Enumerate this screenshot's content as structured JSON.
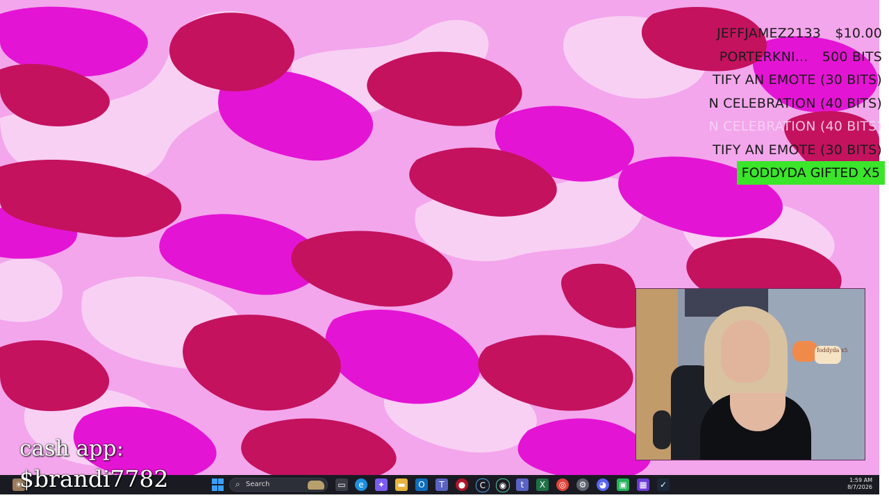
{
  "colors": {
    "camo_light": "#f6c6f2",
    "camo_mid": "#ee82e4",
    "camo_magenta": "#e414d4",
    "camo_dark": "#c4125e",
    "gift_badge_bg": "#3ae52a",
    "taskbar_bg": "#1a1b22"
  },
  "alerts": {
    "rows": [
      {
        "text": "JEFFJAMEZ2133",
        "amount": "$10.00"
      },
      {
        "text": "PORTERKNI...",
        "amount": "500 BITS"
      },
      {
        "text": "TIFY AN EMOTE (30 BITS)",
        "amount": ""
      },
      {
        "text": "N CELEBRATION (40 BITS)",
        "amount": ""
      },
      {
        "text": "N CELEBRATION (40 BITS)",
        "amount": ""
      },
      {
        "text": "TIFY AN EMOTE (30 BITS)",
        "amount": ""
      }
    ],
    "gift_badge": "FODDYDA  GIFTED X5"
  },
  "webcam": {
    "sticker_text": "foddyda x5"
  },
  "overlay": {
    "cash_label": "cash app:",
    "cash_handle": "$brandi7782"
  },
  "taskbar": {
    "search_placeholder": "Search",
    "time": "1:59 AM",
    "date": "8/7/2026",
    "icons": [
      "windows-start-icon",
      "search-icon",
      "task-view-icon",
      "edge-icon",
      "copilot-icon",
      "file-explorer-icon",
      "outlook-icon",
      "teams-icon",
      "red-app-icon",
      "c-app-icon",
      "obs-icon",
      "teams-chat-icon",
      "excel-icon",
      "chrome-icon",
      "settings-icon",
      "discord-icon",
      "green-app-icon",
      "purple-app-icon",
      "steam-icon"
    ]
  }
}
